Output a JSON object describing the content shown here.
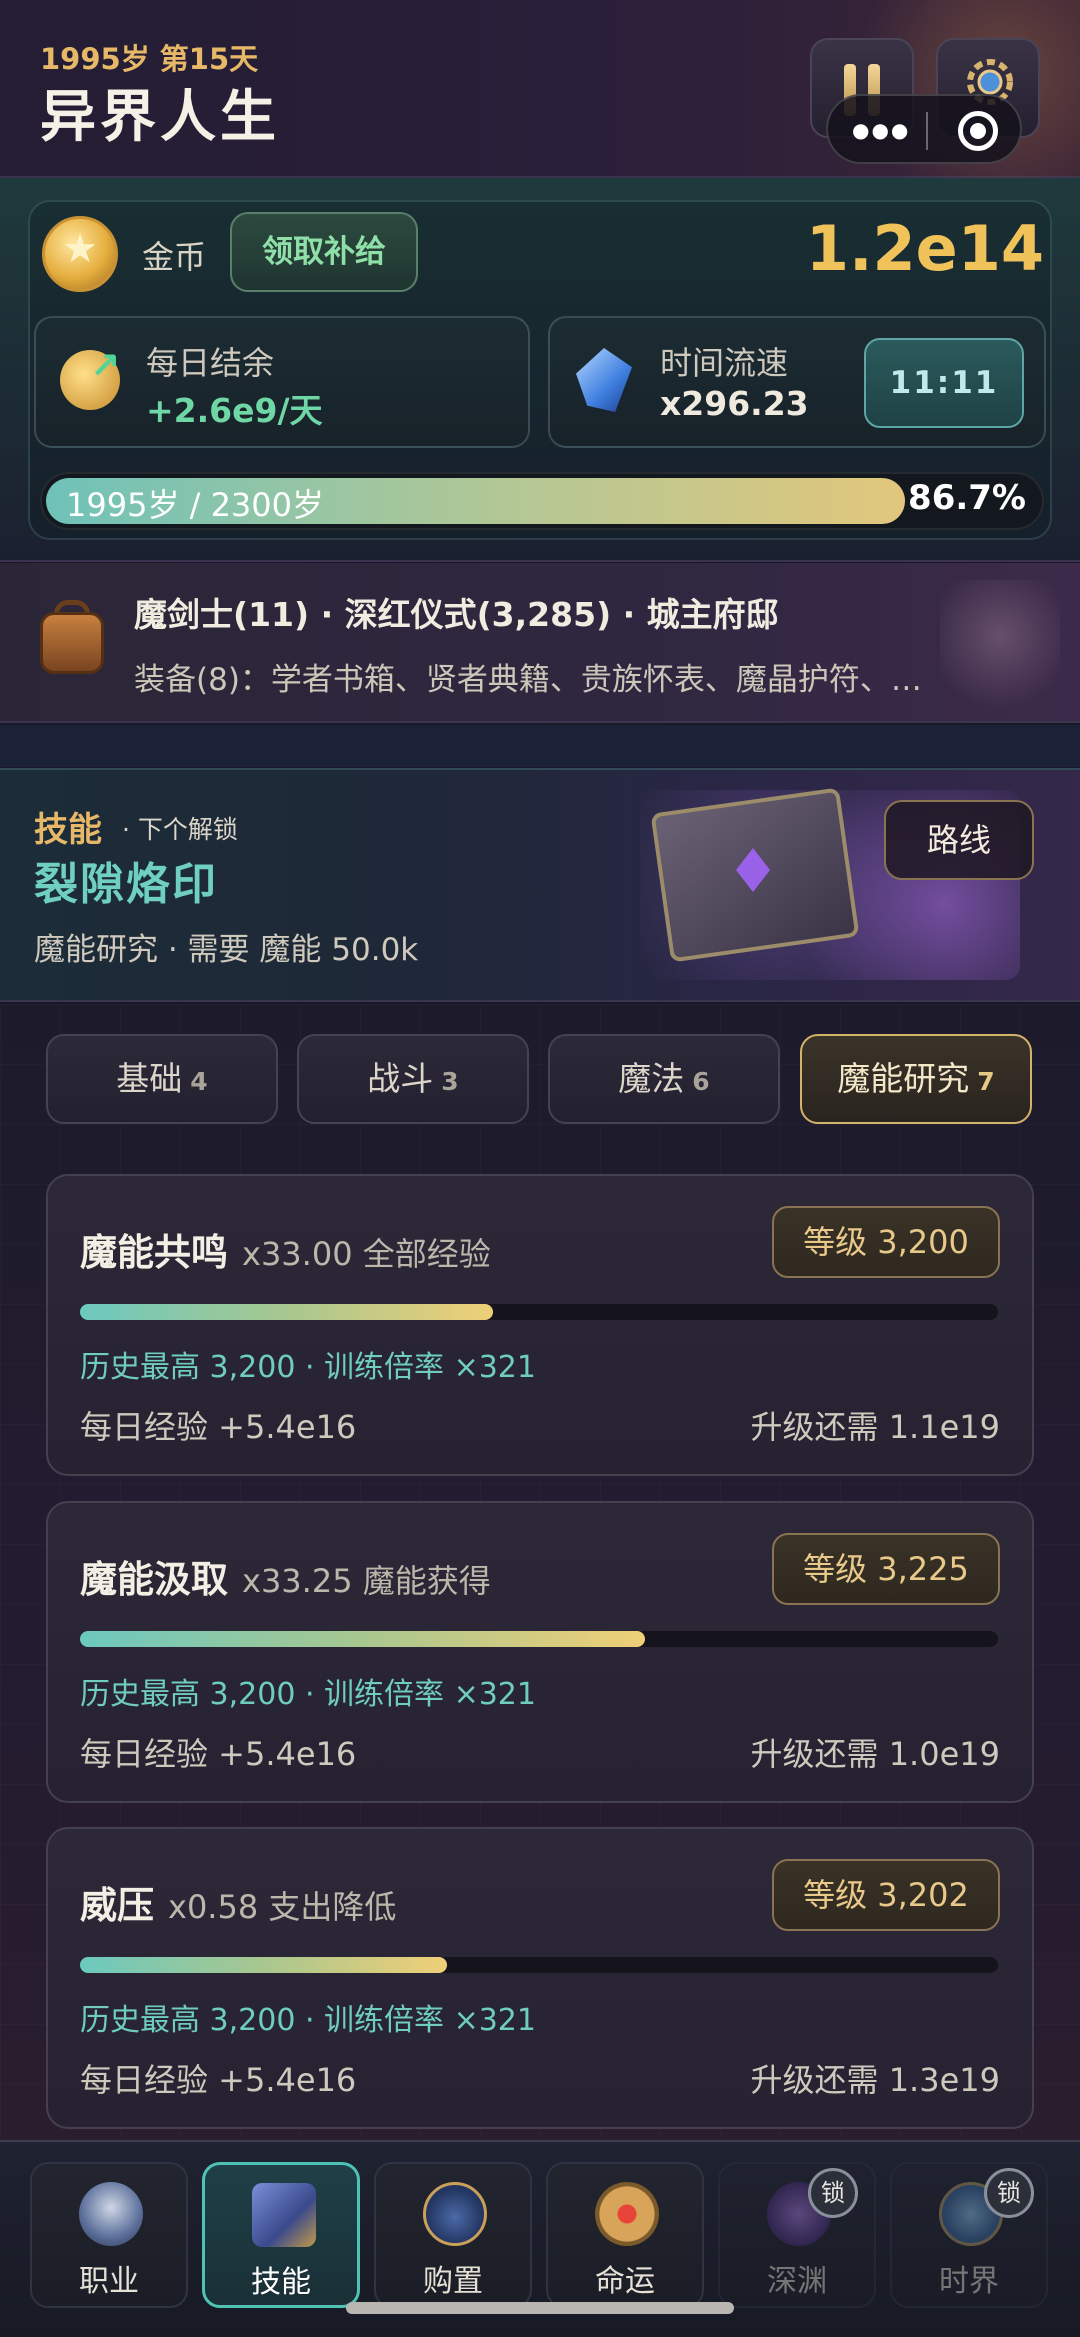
{
  "header": {
    "date": "1995岁 第15天",
    "title": "异界人生"
  },
  "resources": {
    "gold_label": "金币",
    "claim_button": "领取补给",
    "gold_value": "1.2e14",
    "daily_title": "每日结余",
    "daily_value": "+2.6e9/天",
    "speed_title": "时间流速",
    "speed_value": "x296.23",
    "time_button": "11:11",
    "life_text": "1995岁 / 2300岁",
    "life_percent_text": "86.7%",
    "life_fraction": 0.867
  },
  "character": {
    "summary": "魔剑士(11) · 深红仪式(3,285) · 城主府邸",
    "equipment": "装备(8)：学者书箱、贤者典籍、贵族怀表、魔晶护符、…"
  },
  "unlock": {
    "section": "技能",
    "next_label": "· 下个解锁",
    "name": "裂隙烙印",
    "requirement": "魔能研究 · 需要 魔能 50.0k",
    "route_button": "路线"
  },
  "tabs": [
    {
      "label": "基础",
      "count": "4"
    },
    {
      "label": "战斗",
      "count": "3"
    },
    {
      "label": "魔法",
      "count": "6"
    },
    {
      "label": "魔能研究",
      "count": "7"
    }
  ],
  "skills": [
    {
      "name": "魔能共鸣",
      "effect": "x33.00 全部经验",
      "level": "等级 3,200",
      "progress": 0.45,
      "history": "历史最高 3,200 · 训练倍率 ×321",
      "daily": "每日经验 +5.4e16",
      "need": "升级还需 1.1e19"
    },
    {
      "name": "魔能汲取",
      "effect": "x33.25 魔能获得",
      "level": "等级 3,225",
      "progress": 0.615,
      "history": "历史最高 3,200 · 训练倍率 ×321",
      "daily": "每日经验 +5.4e16",
      "need": "升级还需 1.0e19"
    },
    {
      "name": "威压",
      "effect": "x0.58 支出降低",
      "level": "等级 3,202",
      "progress": 0.4,
      "history": "历史最高 3,200 · 训练倍率 ×321",
      "daily": "每日经验 +5.4e16",
      "need": "升级还需 1.3e19"
    }
  ],
  "nav": [
    {
      "label": "职业",
      "icon": "shield-sword-icon",
      "locked": false
    },
    {
      "label": "技能",
      "icon": "spellbook-icon",
      "locked": false,
      "active": true
    },
    {
      "label": "购置",
      "icon": "coin-bag-icon",
      "locked": false
    },
    {
      "label": "命运",
      "icon": "fate-wheel-icon",
      "locked": false
    },
    {
      "label": "深渊",
      "icon": "abyss-crystal-icon",
      "locked": true,
      "lock_label": "锁"
    },
    {
      "label": "时界",
      "icon": "time-hourglass-icon",
      "locked": true,
      "lock_label": "锁"
    }
  ]
}
